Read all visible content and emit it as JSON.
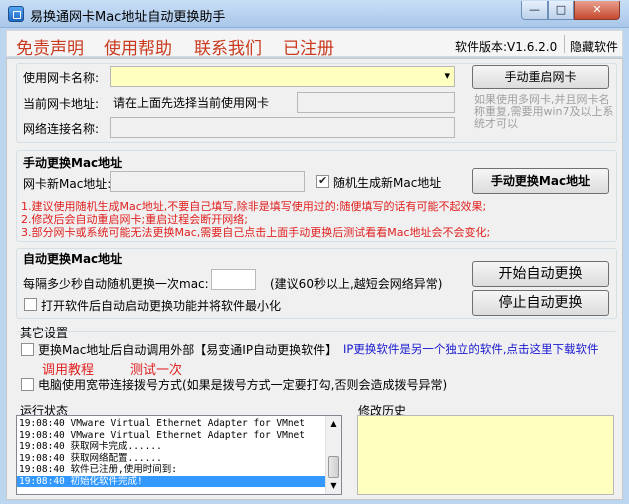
{
  "window": {
    "title": "易换通网卡Mac地址自动更换助手",
    "min_glyph": "—",
    "max_glyph": "□",
    "close_glyph": "✕"
  },
  "menu": {
    "items": [
      "免责声明",
      "使用帮助",
      "联系我们",
      "已注册"
    ],
    "version": "软件版本:V1.6.2.0",
    "hide": "隐藏软件"
  },
  "nic": {
    "name_label": "使用网卡名称:",
    "name_value": "",
    "dropdown_glyph": "▾",
    "addr_label": "当前网卡地址:",
    "addr_value": "请在上面先选择当前使用网卡",
    "conn_label": "网络连接名称:",
    "conn_value": "",
    "restart_button": "手动重启网卡",
    "hint": "如果使用多网卡,并且网卡名称重复,需要用win7及以上系统才可以"
  },
  "manual": {
    "title": "手动更换Mac地址",
    "new_label": "网卡新Mac地址:",
    "new_value": "",
    "random_label": "随机生成新Mac地址",
    "random_checked": true,
    "change_button": "手动更换Mac地址",
    "notes": [
      "1.建议使用随机生成Mac地址,不要自己填写,除非是填写使用过的:随便填写的话有可能不起效果;",
      "2.修改后会自动重启网卡;重启过程会断开网络;",
      "3.部分网卡或系统可能无法更换Mac,需要自己点击上面手动更换后测试看看Mac地址会不会变化;"
    ]
  },
  "auto": {
    "title": "自动更换Mac地址",
    "interval_label": "每隔多少秒自动随机更换一次mac:",
    "interval_value": "",
    "interval_hint": "(建议60秒以上,越短会网络异常)",
    "autostart_label": "打开软件后自动启动更换功能并将软件最小化",
    "start_button": "开始自动更换",
    "stop_button": "停止自动更换"
  },
  "other": {
    "title": "其它设置",
    "external_label": "更换Mac地址后自动调用外部【易变通IP自动更换软件】",
    "ip_link": "IP更换软件是另一个独立的软件,点击这里下载软件",
    "tutorial": "调用教程",
    "test": "测试一次",
    "dialup_label": "电脑使用宽带连接拨号方式(如果是拨号方式一定要打勾,否则会造成拨号异常)"
  },
  "log": {
    "title": "运行状态",
    "lines": [
      "19:08:40 VMware Virtual Ethernet Adapter for VMnet",
      "19:08:40 VMware Virtual Ethernet Adapter for VMnet",
      "19:08:40 获取网卡完成......",
      "19:08:40 获取网络配置......",
      "19:08:40 软件已注册,使用时间到:",
      "19:08:40 初始化软件完成!"
    ]
  },
  "history": {
    "title": "修改历史"
  },
  "colors": {
    "menu_red": "#c93a1e",
    "note_red": "#e02020",
    "link_blue": "#1a1ad0",
    "field_yellow": "#ffffc0",
    "selection_blue": "#3399ff"
  }
}
